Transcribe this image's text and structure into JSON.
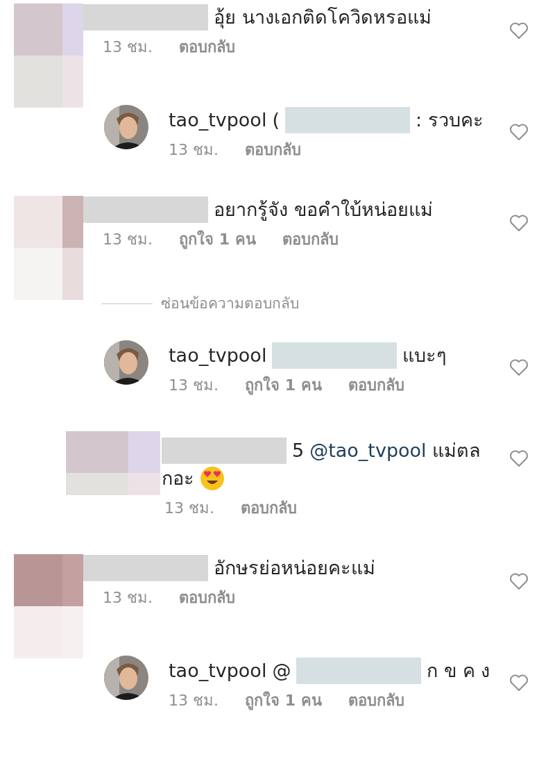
{
  "comments": [
    {
      "kind": "comment",
      "lines": [
        [
          {
            "kind": "censor"
          },
          {
            "kind": "plain",
            "text": "อุ้ย นางเอกติดโควิดหรอแม่"
          }
        ]
      ],
      "time": "13 ชม.",
      "reply": "ตอบกลับ"
    },
    {
      "kind": "reply",
      "username": "tao_tvpool",
      "lines": [
        [
          {
            "kind": "plain",
            "text": "("
          },
          {
            "kind": "censor"
          },
          {
            "kind": "plain",
            "text": ": รวบคะ"
          }
        ]
      ],
      "time": "13 ชม.",
      "reply": "ตอบกลับ"
    },
    {
      "kind": "comment",
      "lines": [
        [
          {
            "kind": "censor"
          },
          {
            "kind": "plain",
            "text": "อยากรู้จัง ขอคำใบ้หน่อยแม่"
          }
        ]
      ],
      "time": "13 ชม.",
      "likes": "ถูกใจ 1 คน",
      "reply": "ตอบกลับ",
      "hide_replies": "ซ่อนข้อความตอบกลับ"
    },
    {
      "kind": "reply",
      "username": "tao_tvpool",
      "lines": [
        [
          {
            "kind": "censor"
          },
          {
            "kind": "plain",
            "text": "แบะๆ"
          }
        ]
      ],
      "time": "13 ชม.",
      "likes": "ถูกใจ 1 คน",
      "reply": "ตอบกลับ"
    },
    {
      "kind": "mosaic-reply",
      "lines": [
        [
          {
            "kind": "censor"
          },
          {
            "kind": "plain",
            "text": "5"
          },
          {
            "kind": "mention",
            "text": "@tao_tvpool"
          },
          {
            "kind": "plain",
            "text": "แม่ตล"
          }
        ],
        [
          {
            "kind": "plain",
            "text": "กอะ"
          },
          {
            "kind": "emoji"
          }
        ]
      ],
      "time": "13 ชม.",
      "reply": "ตอบกลับ"
    },
    {
      "kind": "comment",
      "lines": [
        [
          {
            "kind": "censor"
          },
          {
            "kind": "plain",
            "text": "อักษรย่อหน่อยคะแม่"
          }
        ]
      ],
      "time": "13 ชม.",
      "reply": "ตอบกลับ"
    },
    {
      "kind": "reply",
      "username": "tao_tvpool",
      "lines": [
        [
          {
            "kind": "plain",
            "text": "@"
          },
          {
            "kind": "censor"
          },
          {
            "kind": "plain",
            "text": "ก ข ค ง"
          }
        ]
      ],
      "time": "13 ชม.",
      "likes": "ถูกใจ 1 คน",
      "reply": "ตอบกลับ"
    }
  ]
}
